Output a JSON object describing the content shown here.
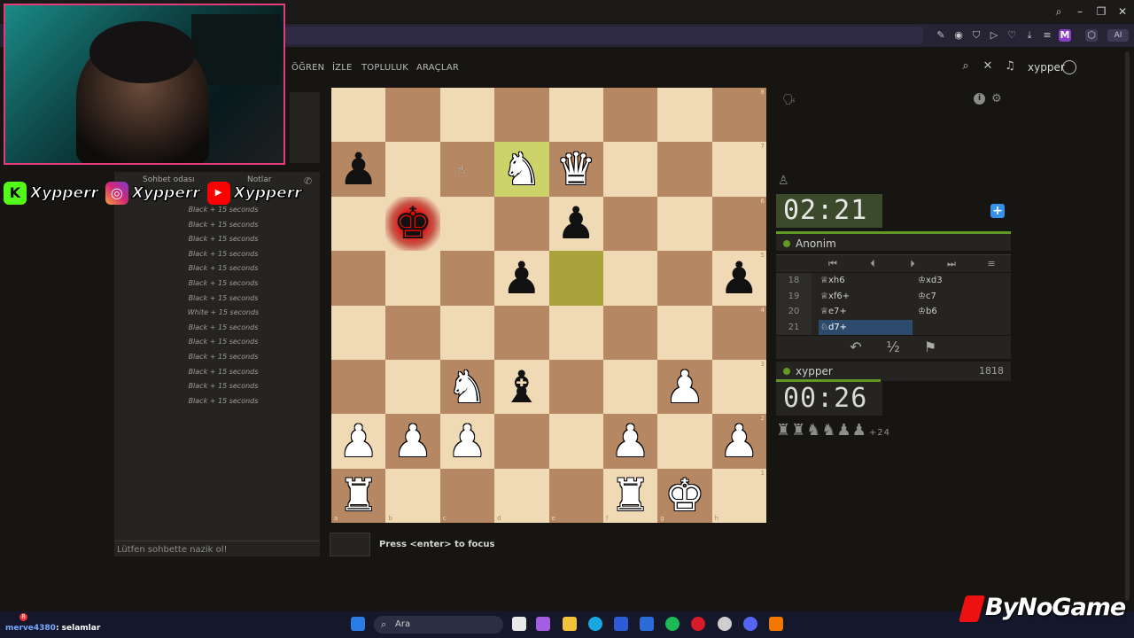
{
  "nav": {
    "items": [
      "ÖĞREN",
      "İZLE",
      "TOPLULUK",
      "ARAÇLAR"
    ],
    "username": "xypper"
  },
  "browser": {
    "ext_letter": "M",
    "ai_label": "AI"
  },
  "social": {
    "handle1": "Xypperr",
    "handle2": "Xypperr",
    "handle3": "Xypperr"
  },
  "chat": {
    "tabs": [
      "Sohbet odası",
      "Notlar"
    ],
    "lines": [
      "Black + 15 seconds",
      "Black + 15 seconds",
      "Black + 15 seconds",
      "Black + 15 seconds",
      "Black + 15 seconds",
      "Black + 15 seconds",
      "Black + 15 seconds",
      "White + 15 seconds",
      "Black + 15 seconds",
      "Black + 15 seconds",
      "Black + 15 seconds",
      "Black + 15 seconds",
      "Black + 15 seconds",
      "Black + 15 seconds"
    ],
    "placeholder": "Lütfen sohbette nazik ol!"
  },
  "board": {
    "ranks": [
      "8",
      "7",
      "6",
      "5",
      "4",
      "3",
      "2",
      "1"
    ],
    "files": [
      "a",
      "b",
      "c",
      "d",
      "e",
      "f",
      "g",
      "h"
    ],
    "pieces": {
      "a7": "bP",
      "d7": "wN",
      "e7": "wQ",
      "b6": "bK",
      "e6": "bP",
      "d5": "bP",
      "h5": "bP",
      "c3": "wN",
      "d3": "bB",
      "g3": "wP",
      "a2": "wP",
      "b2": "wP",
      "c2": "wP",
      "f2": "wP",
      "h2": "wP",
      "a1": "wR",
      "f1": "wR",
      "g1": "wK"
    },
    "last_move": [
      "d7",
      "e5"
    ],
    "check": "b6"
  },
  "focus_hint": "Press <enter> to focus",
  "game": {
    "top_clock": "02:21",
    "bottom_clock": "00:26",
    "top_player": "Anonim",
    "bottom_player": "xypper",
    "bottom_rating": "1818",
    "moves": [
      {
        "no": "18",
        "white": "♕xh6",
        "black": "♔xd3"
      },
      {
        "no": "19",
        "white": "♕xf6+",
        "black": "♔c7"
      },
      {
        "no": "20",
        "white": "♕e7+",
        "black": "♔b6"
      },
      {
        "no": "21",
        "white": "♘d7+",
        "black": ""
      }
    ],
    "captured": "♜♜♞♞♟♟",
    "material_adv": "+24"
  },
  "taskbar": {
    "search_placeholder": "Ara",
    "notif_count": "8"
  },
  "overlay": {
    "chat_user": "merve4380",
    "chat_msg": ": selamlar",
    "brand": "ByNoGame"
  },
  "colors": {
    "accent": "#629924",
    "check": "#e70000",
    "board_light": "#f0d9b5",
    "board_dark": "#b58863"
  }
}
